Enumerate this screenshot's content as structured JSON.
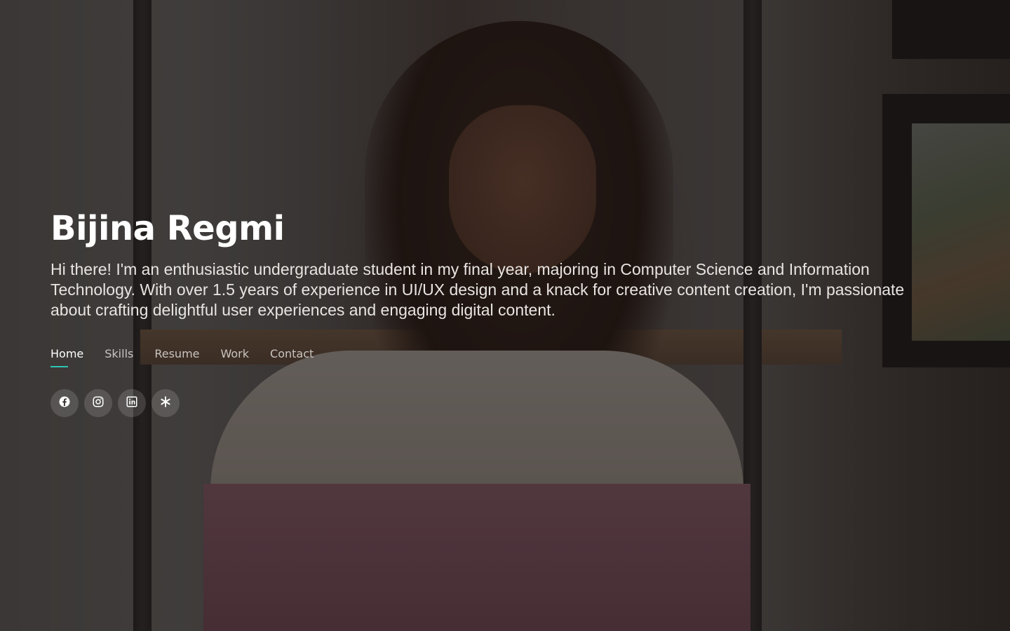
{
  "profile": {
    "name": "Bijina Regmi",
    "bio": "Hi there! I'm an enthusiastic undergraduate student in my final year, majoring in Computer Science and Information Technology. With over 1.5 years of experience in UI/UX design and a knack for creative content creation, I'm passionate about crafting delightful user experiences and engaging digital content."
  },
  "nav": {
    "items": [
      {
        "label": "Home",
        "active": true
      },
      {
        "label": "Skills",
        "active": false
      },
      {
        "label": "Resume",
        "active": false
      },
      {
        "label": "Work",
        "active": false
      },
      {
        "label": "Contact",
        "active": false
      }
    ]
  },
  "socials": [
    {
      "icon": "facebook-icon"
    },
    {
      "icon": "instagram-icon"
    },
    {
      "icon": "linkedin-icon"
    },
    {
      "icon": "dribbble-icon"
    }
  ],
  "colors": {
    "accent": "#2ec4b6",
    "overlay": "#141212"
  }
}
